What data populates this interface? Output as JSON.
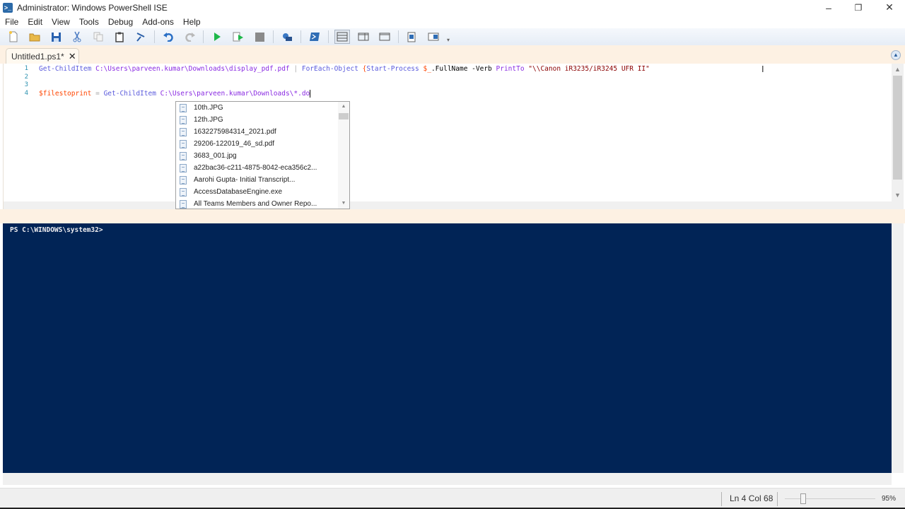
{
  "window": {
    "title": "Administrator: Windows PowerShell ISE",
    "app_icon": "powershell-icon",
    "controls": {
      "minimize": "–",
      "restore": "❐",
      "close": "✕"
    }
  },
  "menu": [
    "File",
    "Edit",
    "View",
    "Tools",
    "Debug",
    "Add-ons",
    "Help"
  ],
  "toolbar": [
    {
      "name": "new-icon"
    },
    {
      "name": "open-icon"
    },
    {
      "name": "save-icon"
    },
    {
      "name": "cut-icon"
    },
    {
      "name": "copy-icon"
    },
    {
      "name": "paste-icon"
    },
    {
      "name": "clear-console-icon"
    },
    {
      "name": "undo-icon"
    },
    {
      "name": "redo-icon"
    },
    {
      "name": "run-icon"
    },
    {
      "name": "run-selection-icon"
    },
    {
      "name": "stop-icon"
    },
    {
      "name": "remote-tab-icon"
    },
    {
      "name": "start-powershell-icon"
    },
    {
      "name": "show-script-top-icon"
    },
    {
      "name": "show-script-right-icon"
    },
    {
      "name": "show-script-max-icon"
    },
    {
      "name": "show-commands-icon"
    },
    {
      "name": "show-commands-addon-icon"
    }
  ],
  "tab": {
    "label": "Untitled1.ps1*",
    "close": "✕"
  },
  "editor": {
    "line_numbers": [
      "1",
      "2",
      "3",
      "4"
    ],
    "lines": [
      [
        {
          "t": "Get-ChildItem",
          "c": "cm"
        },
        {
          "t": " "
        },
        {
          "t": "C:\\Users\\parveen.kumar\\Downloads\\display_pdf.pdf",
          "c": "arg"
        },
        {
          "t": " "
        },
        {
          "t": "|",
          "c": "op"
        },
        {
          "t": " "
        },
        {
          "t": "ForEach-Object",
          "c": "cm"
        },
        {
          "t": " "
        },
        {
          "t": "{",
          "c": "var"
        },
        {
          "t": "Start-Process",
          "c": "cm"
        },
        {
          "t": " "
        },
        {
          "t": "$_",
          "c": "var"
        },
        {
          "t": ".FullName",
          "c": ""
        },
        {
          "t": " "
        },
        {
          "t": "-Verb",
          "c": ""
        },
        {
          "t": " "
        },
        {
          "t": "PrintTo",
          "c": "arg"
        },
        {
          "t": " "
        },
        {
          "t": "\"\\\\Canon iR3235/iR3245 UFR II\"",
          "c": "str"
        }
      ],
      [],
      [],
      [
        {
          "t": "$filestoprint",
          "c": "var"
        },
        {
          "t": " "
        },
        {
          "t": "=",
          "c": "op"
        },
        {
          "t": " "
        },
        {
          "t": "Get-ChildItem",
          "c": "cm"
        },
        {
          "t": " "
        },
        {
          "t": "C:\\Users\\parveen.kumar\\Downloads\\*.do",
          "c": "arg"
        }
      ]
    ]
  },
  "autocomplete": {
    "items": [
      "10th.JPG",
      "12th.JPG",
      "1632275984314_2021.pdf",
      "29206-122019_46_sd.pdf",
      "3683_001.jpg",
      "a22bac36-c211-4875-8042-eca356c2...",
      "Aarohi Gupta- Initial Transcript...",
      "AccessDatabaseEngine.exe",
      "All Teams Members and Owner Repo..."
    ]
  },
  "console": {
    "prompt": "PS C:\\WINDOWS\\system32>"
  },
  "status": {
    "position": "Ln 4  Col 68",
    "zoom": "95%",
    "zoom_value": 95
  },
  "colors": {
    "console_bg": "#012456",
    "tab_bg": "#fdf1e3"
  }
}
